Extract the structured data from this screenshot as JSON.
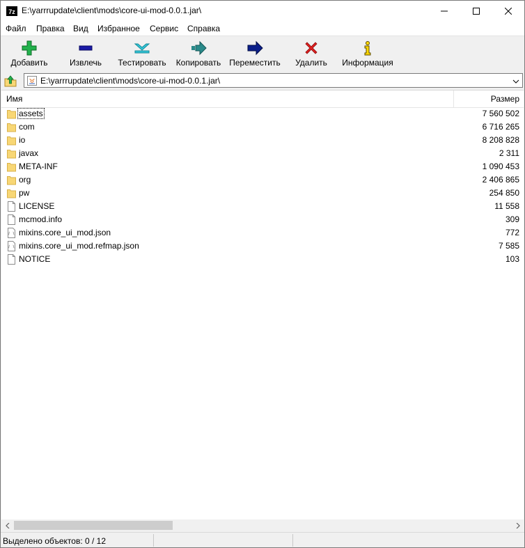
{
  "window": {
    "app_icon_text": "7z",
    "title": "E:\\yarrrupdate\\client\\mods\\core-ui-mod-0.0.1.jar\\"
  },
  "menu": [
    {
      "label": "Файл"
    },
    {
      "label": "Правка"
    },
    {
      "label": "Вид"
    },
    {
      "label": "Избранное"
    },
    {
      "label": "Сервис"
    },
    {
      "label": "Справка"
    }
  ],
  "toolbar": {
    "add": "Добавить",
    "extract": "Извлечь",
    "test": "Тестировать",
    "copy": "Копировать",
    "move": "Переместить",
    "delete": "Удалить",
    "info": "Информация"
  },
  "address": {
    "path": "E:\\yarrrupdate\\client\\mods\\core-ui-mod-0.0.1.jar\\"
  },
  "columns": {
    "name": "Имя",
    "size": "Размер"
  },
  "files": [
    {
      "name": "assets",
      "size": "7 560 502",
      "type": "folder"
    },
    {
      "name": "com",
      "size": "6 716 265",
      "type": "folder"
    },
    {
      "name": "io",
      "size": "8 208 828",
      "type": "folder"
    },
    {
      "name": "javax",
      "size": "2 311",
      "type": "folder"
    },
    {
      "name": "META-INF",
      "size": "1 090 453",
      "type": "folder"
    },
    {
      "name": "org",
      "size": "2 406 865",
      "type": "folder"
    },
    {
      "name": "pw",
      "size": "254 850",
      "type": "folder"
    },
    {
      "name": "LICENSE",
      "size": "11 558",
      "type": "file"
    },
    {
      "name": "mcmod.info",
      "size": "309",
      "type": "file"
    },
    {
      "name": "mixins.core_ui_mod.json",
      "size": "772",
      "type": "json"
    },
    {
      "name": "mixins.core_ui_mod.refmap.json",
      "size": "7 585",
      "type": "json"
    },
    {
      "name": "NOTICE",
      "size": "103",
      "type": "file"
    }
  ],
  "status": {
    "selected": "Выделено объектов: 0 / 12"
  },
  "colors": {
    "folder": "#f8d775",
    "add_icon": "#22b14c",
    "extract_icon": "#1a1aa6",
    "test_icon": "#35c6d8",
    "copy_icon": "#2a8a8a",
    "move_icon": "#0b1f8a",
    "delete_icon": "#e02020",
    "info_icon": "#ffd800"
  }
}
